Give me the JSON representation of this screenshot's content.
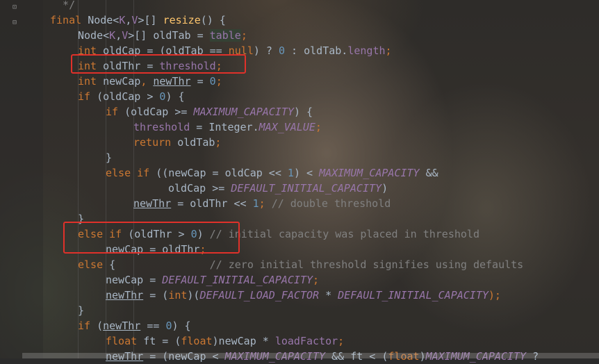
{
  "editor": {
    "lines": [
      {
        "indent": 0,
        "tokens": [
          {
            "t": "  */",
            "c": "cm"
          }
        ]
      },
      {
        "indent": 0,
        "tokens": [
          {
            "t": "final ",
            "c": "kw"
          },
          {
            "t": "Node<"
          },
          {
            "t": "K",
            "c": "tp"
          },
          {
            "t": ","
          },
          {
            "t": "V",
            "c": "tp"
          },
          {
            "t": ">[] "
          },
          {
            "t": "resize",
            "c": "fn"
          },
          {
            "t": "() {"
          }
        ]
      },
      {
        "indent": 1,
        "tokens": [
          {
            "t": "Node<"
          },
          {
            "t": "K",
            "c": "tp"
          },
          {
            "t": ","
          },
          {
            "t": "V",
            "c": "tp"
          },
          {
            "t": ">[] oldTab = "
          },
          {
            "t": "table",
            "c": "tp hl"
          },
          {
            "t": ";",
            "c": "kw"
          }
        ]
      },
      {
        "indent": 1,
        "tokens": [
          {
            "t": "int ",
            "c": "kw"
          },
          {
            "t": "oldCap = (oldTab == "
          },
          {
            "t": "null",
            "c": "kw"
          },
          {
            "t": ") ? "
          },
          {
            "t": "0",
            "c": "num"
          },
          {
            "t": " : oldTab."
          },
          {
            "t": "length",
            "c": "tp"
          },
          {
            "t": ";",
            "c": "kw"
          }
        ]
      },
      {
        "indent": 1,
        "tokens": [
          {
            "t": "int ",
            "c": "kw"
          },
          {
            "t": "oldThr = "
          },
          {
            "t": "threshold",
            "c": "tp"
          },
          {
            "t": ";",
            "c": "kw"
          }
        ]
      },
      {
        "indent": 1,
        "tokens": [
          {
            "t": "int ",
            "c": "kw"
          },
          {
            "t": "newCap"
          },
          {
            "t": ", ",
            "c": "kw"
          },
          {
            "t": "newThr",
            "c": "ul"
          },
          {
            "t": " = "
          },
          {
            "t": "0",
            "c": "num"
          },
          {
            "t": ";",
            "c": "kw"
          }
        ]
      },
      {
        "indent": 1,
        "tokens": [
          {
            "t": "if ",
            "c": "kw"
          },
          {
            "t": "(oldCap > "
          },
          {
            "t": "0",
            "c": "num"
          },
          {
            "t": ") {"
          }
        ]
      },
      {
        "indent": 2,
        "tokens": [
          {
            "t": "if ",
            "c": "kw"
          },
          {
            "t": "(oldCap >= "
          },
          {
            "t": "MAXIMUM_CAPACITY",
            "c": "const"
          },
          {
            "t": ") {"
          }
        ]
      },
      {
        "indent": 3,
        "tokens": [
          {
            "t": "threshold",
            "c": "tp"
          },
          {
            "t": " = Integer."
          },
          {
            "t": "MAX_VALUE",
            "c": "const"
          },
          {
            "t": ";",
            "c": "kw"
          }
        ]
      },
      {
        "indent": 3,
        "tokens": [
          {
            "t": "return ",
            "c": "kw"
          },
          {
            "t": "oldTab"
          },
          {
            "t": ";",
            "c": "kw"
          }
        ]
      },
      {
        "indent": 2,
        "tokens": [
          {
            "t": "}"
          }
        ]
      },
      {
        "indent": 2,
        "tokens": [
          {
            "t": "else if ",
            "c": "kw"
          },
          {
            "t": "((newCap = oldCap << "
          },
          {
            "t": "1",
            "c": "num"
          },
          {
            "t": ") < "
          },
          {
            "t": "MAXIMUM_CAPACITY",
            "c": "const"
          },
          {
            "t": " &&"
          }
        ]
      },
      {
        "indent": 4.25,
        "tokens": [
          {
            "t": "oldCap >= "
          },
          {
            "t": "DEFAULT_INITIAL_CAPACITY",
            "c": "const"
          },
          {
            "t": ")"
          }
        ]
      },
      {
        "indent": 3,
        "tokens": [
          {
            "t": "newThr",
            "c": "ul"
          },
          {
            "t": " = oldThr << "
          },
          {
            "t": "1",
            "c": "num"
          },
          {
            "t": "; ",
            "c": "kw"
          },
          {
            "t": "// double threshold",
            "c": "cm"
          }
        ]
      },
      {
        "indent": 1,
        "tokens": [
          {
            "t": "}"
          }
        ]
      },
      {
        "indent": 1,
        "tokens": [
          {
            "t": "else if ",
            "c": "kw"
          },
          {
            "t": "(oldThr > "
          },
          {
            "t": "0",
            "c": "num"
          },
          {
            "t": ") "
          },
          {
            "t": "// initial capacity was placed in threshold",
            "c": "cm"
          }
        ]
      },
      {
        "indent": 2,
        "tokens": [
          {
            "t": "newCap = oldThr"
          },
          {
            "t": ";",
            "c": "kw"
          }
        ]
      },
      {
        "indent": 1,
        "tokens": [
          {
            "t": "else ",
            "c": "kw"
          },
          {
            "t": "{               "
          },
          {
            "t": "// zero initial threshold signifies using defaults",
            "c": "cm"
          }
        ]
      },
      {
        "indent": 2,
        "tokens": [
          {
            "t": "newCap = "
          },
          {
            "t": "DEFAULT_INITIAL_CAPACITY",
            "c": "const"
          },
          {
            "t": ";",
            "c": "kw"
          }
        ]
      },
      {
        "indent": 2,
        "tokens": [
          {
            "t": "newThr",
            "c": "ul"
          },
          {
            "t": " = ("
          },
          {
            "t": "int",
            "c": "kw"
          },
          {
            "t": ")("
          },
          {
            "t": "DEFAULT_LOAD_FACTOR",
            "c": "const"
          },
          {
            "t": " * "
          },
          {
            "t": "DEFAULT_INITIAL_CAPACITY",
            "c": "const"
          },
          {
            "t": ");",
            "c": "kw"
          }
        ]
      },
      {
        "indent": 1,
        "tokens": [
          {
            "t": "}"
          }
        ]
      },
      {
        "indent": 1,
        "tokens": [
          {
            "t": "if ",
            "c": "kw"
          },
          {
            "t": "("
          },
          {
            "t": "newThr",
            "c": "ul"
          },
          {
            "t": " == "
          },
          {
            "t": "0",
            "c": "num"
          },
          {
            "t": ") {"
          }
        ]
      },
      {
        "indent": 2,
        "tokens": [
          {
            "t": "float ",
            "c": "kw"
          },
          {
            "t": "ft = ("
          },
          {
            "t": "float",
            "c": "kw"
          },
          {
            "t": ")newCap * "
          },
          {
            "t": "loadFactor",
            "c": "tp"
          },
          {
            "t": ";",
            "c": "kw"
          }
        ]
      },
      {
        "indent": 2,
        "tokens": [
          {
            "t": "newThr",
            "c": "ul"
          },
          {
            "t": " = (newCap < "
          },
          {
            "t": "MAXIMUM_CAPACITY",
            "c": "const"
          },
          {
            "t": " && ft < ("
          },
          {
            "t": "float",
            "c": "kw"
          },
          {
            "t": ")"
          },
          {
            "t": "MAXIMUM_CAPACITY",
            "c": "const"
          },
          {
            "t": " ?"
          }
        ]
      }
    ]
  },
  "colors": {
    "background": "#2b2b2b",
    "keyword": "#cc7832",
    "method": "#ffc66d",
    "field": "#9876aa",
    "number": "#6897bb",
    "comment": "#808080",
    "text": "#a9b7c6",
    "annotation_box": "#e0312a"
  },
  "annotations": [
    {
      "label": "highlight-oldThr-threshold"
    },
    {
      "label": "highlight-else-if-oldThr"
    }
  ]
}
